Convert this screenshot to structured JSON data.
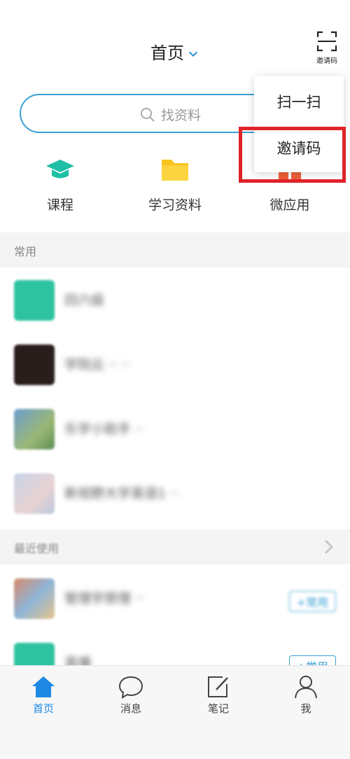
{
  "header": {
    "title": "首页",
    "invite_button_label": "邀请码"
  },
  "search": {
    "placeholder": "找资料"
  },
  "quick_actions": [
    {
      "label": "课程",
      "icon": "graduation-cap-icon",
      "color": "#1fbfa5"
    },
    {
      "label": "学习资料",
      "icon": "folder-icon",
      "color": "#f8c51c"
    },
    {
      "label": "微应用",
      "icon": "gift-icon",
      "color": "#f0613a"
    }
  ],
  "popup_menu": {
    "items": [
      "扫一扫",
      "邀请码"
    ],
    "highlighted": "邀请码"
  },
  "sections": {
    "frequent": {
      "label": "常用"
    },
    "recent": {
      "label": "最近使用"
    }
  },
  "frequent_items": [
    {
      "text": "四六级"
    },
    {
      "text": "学院云 ·· ··"
    },
    {
      "text": "乐学小助手 ··"
    },
    {
      "text": "新视野大学英语1 ··"
    }
  ],
  "recent_items": [
    {
      "text": "管理学原理 ··",
      "tag": "+常用"
    },
    {
      "text": "直播",
      "tag": "+常用"
    }
  ],
  "tabbar": {
    "items": [
      {
        "label": "首页",
        "icon": "home-icon",
        "active": true
      },
      {
        "label": "消息",
        "icon": "message-icon",
        "active": false
      },
      {
        "label": "笔记",
        "icon": "note-icon",
        "active": false
      },
      {
        "label": "我",
        "icon": "user-icon",
        "active": false
      }
    ]
  },
  "colors": {
    "accent": "#1e88e5",
    "search_border": "#3a9fd6",
    "highlight_box": "#e0232b"
  }
}
